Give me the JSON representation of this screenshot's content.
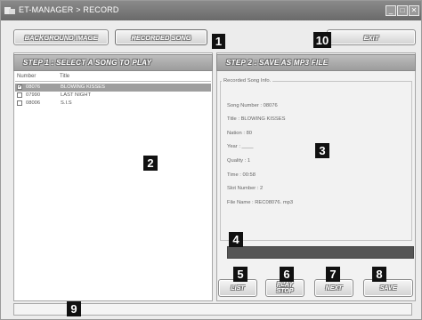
{
  "window": {
    "title": "ET-MANAGER > RECORD"
  },
  "window_controls": {
    "minimize": "_",
    "maximize": "□",
    "close": "✕"
  },
  "top_buttons": {
    "background_image": "BACKGROUND IMAGE",
    "recorded_song": "RECORDED SONG",
    "exit": "EXIT"
  },
  "step1": {
    "header": "STEP 1 : SELECT A SONG TO PLAY",
    "columns": {
      "number": "Number",
      "title": "Title"
    },
    "songs": [
      {
        "number": "08076",
        "title": "BLOWING KISSES",
        "checked": true,
        "selected": true
      },
      {
        "number": "07990",
        "title": "LAST NIGHT",
        "checked": false,
        "selected": false
      },
      {
        "number": "08006",
        "title": "S.I.S",
        "checked": false,
        "selected": false
      }
    ]
  },
  "step2": {
    "header": "STEP 2 : SAVE AS MP3 FILE",
    "group_label": "Recorded Song Info.",
    "lines": [
      "Song Number : 08076",
      "Title : BLOWING KISSES",
      "Nation : 80",
      "Year : ____",
      "Quality : 1",
      "Time : 00:58",
      "Slot Number : 2",
      "File Name : REC08076. mp3"
    ],
    "progress": 0
  },
  "bottom_buttons": {
    "list": "LIST",
    "play_stop_1": "PLAY",
    "play_stop_2": "STOP",
    "next": "NEXT",
    "save": "SAVE"
  },
  "callouts": {
    "c1": "1",
    "c2": "2",
    "c3": "3",
    "c4": "4",
    "c5": "5",
    "c6": "6",
    "c7": "7",
    "c8": "8",
    "c9": "9",
    "c10": "10"
  }
}
